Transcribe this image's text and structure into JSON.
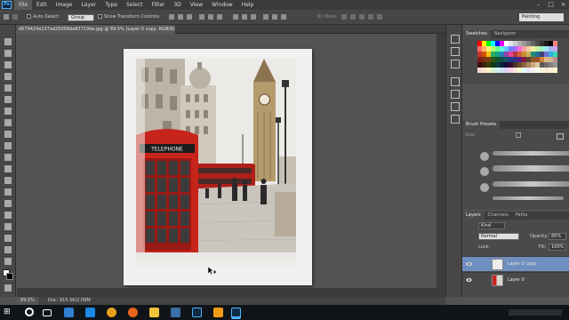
{
  "app": {
    "logo": "Ps",
    "menu": [
      "File",
      "Edit",
      "Image",
      "Layer",
      "Type",
      "Select",
      "Filter",
      "3D",
      "View",
      "Window",
      "Help"
    ],
    "active_menu": "File"
  },
  "options": {
    "auto_select_label": "Auto-Select:",
    "auto_select_value": "Group",
    "transform_label": "Show Transform Controls",
    "mode_3d_label": "3D Mode:",
    "workspace": "Painting"
  },
  "document": {
    "tab_title": "d579424a137ad25058da83719de.jpg @ 89.5% (Layer 0 copy, RGB/8) *",
    "status_zoom": "89.5%",
    "status_doc": "Doc: 915.5K/2.09M",
    "phone_booth_sign": "TELEPHONE"
  },
  "panels": {
    "swatches": {
      "tabs": [
        "Swatches",
        "Navigator"
      ]
    },
    "brush_presets": {
      "title": "Brush Presets",
      "size_label": "Size:"
    },
    "layers": {
      "tabs": [
        "Layers",
        "Channels",
        "Paths"
      ],
      "kind_label": "Kind",
      "blend_mode": "Normal",
      "opacity_label": "Opacity:",
      "opacity_value": "85%",
      "lock_label": "Lock:",
      "fill_label": "Fill:",
      "fill_value": "100%",
      "items": [
        {
          "name": "Layer 0 copy",
          "selected": true
        },
        {
          "name": "Layer 0",
          "selected": false
        }
      ]
    }
  },
  "colors": {
    "accent_blue": "#6f8fbf",
    "booth_red": "#c7241b",
    "bus_red": "#b0201a"
  }
}
